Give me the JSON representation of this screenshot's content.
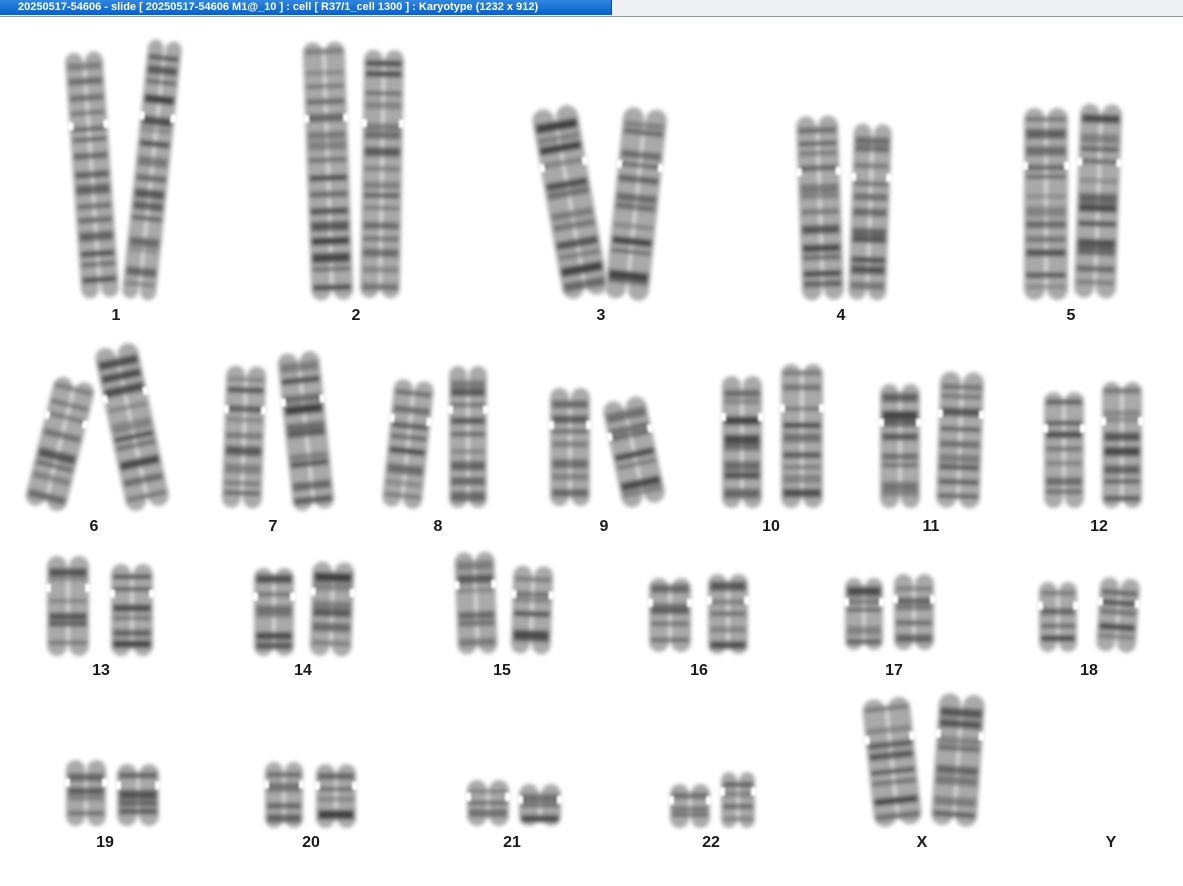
{
  "window": {
    "title": "20250517-54606 - slide [ 20250517-54606 M1@_10 ] : cell [ R37/1_cell 1300 ] : Karyotype  (1232 x 912)"
  },
  "karyotype": {
    "labels": [
      "1",
      "2",
      "3",
      "4",
      "5",
      "6",
      "7",
      "8",
      "9",
      "10",
      "11",
      "12",
      "13",
      "14",
      "15",
      "16",
      "17",
      "18",
      "19",
      "20",
      "21",
      "22",
      "X",
      "Y"
    ]
  },
  "colors": {
    "titlebar": "#0a5fc7",
    "chromatin_dark": "#3a3a3a",
    "chromatin_light": "#bdbdbd"
  }
}
